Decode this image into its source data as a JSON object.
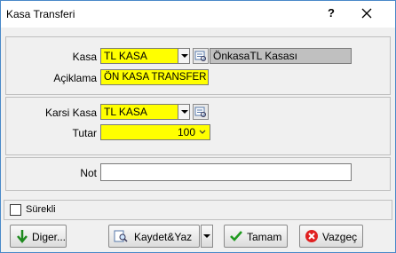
{
  "window": {
    "title": "Kasa Transferi",
    "help_label": "?"
  },
  "form": {
    "kasa_label": "Kasa",
    "kasa_value": "TL KASA",
    "kasa_desc": "ÖnkasaTL Kasası",
    "aciklama_label": "Açiklama",
    "aciklama_value": "ÖN KASA TRANSFER",
    "karsi_kasa_label": "Karsi Kasa",
    "karsi_kasa_value": "TL KASA",
    "tutar_label": "Tutar",
    "tutar_value": "100",
    "not_label": "Not",
    "not_value": ""
  },
  "footer": {
    "surekli_label": "Sürekli",
    "surekli_checked": false
  },
  "buttons": {
    "diger_label": "Diger...",
    "kaydet_label": "Kaydet&Yaz",
    "tamam_label": "Tamam",
    "vazgec_label": "Vazgeç"
  },
  "colors": {
    "highlight": "#ffff00",
    "readonly": "#c0c0c0"
  }
}
